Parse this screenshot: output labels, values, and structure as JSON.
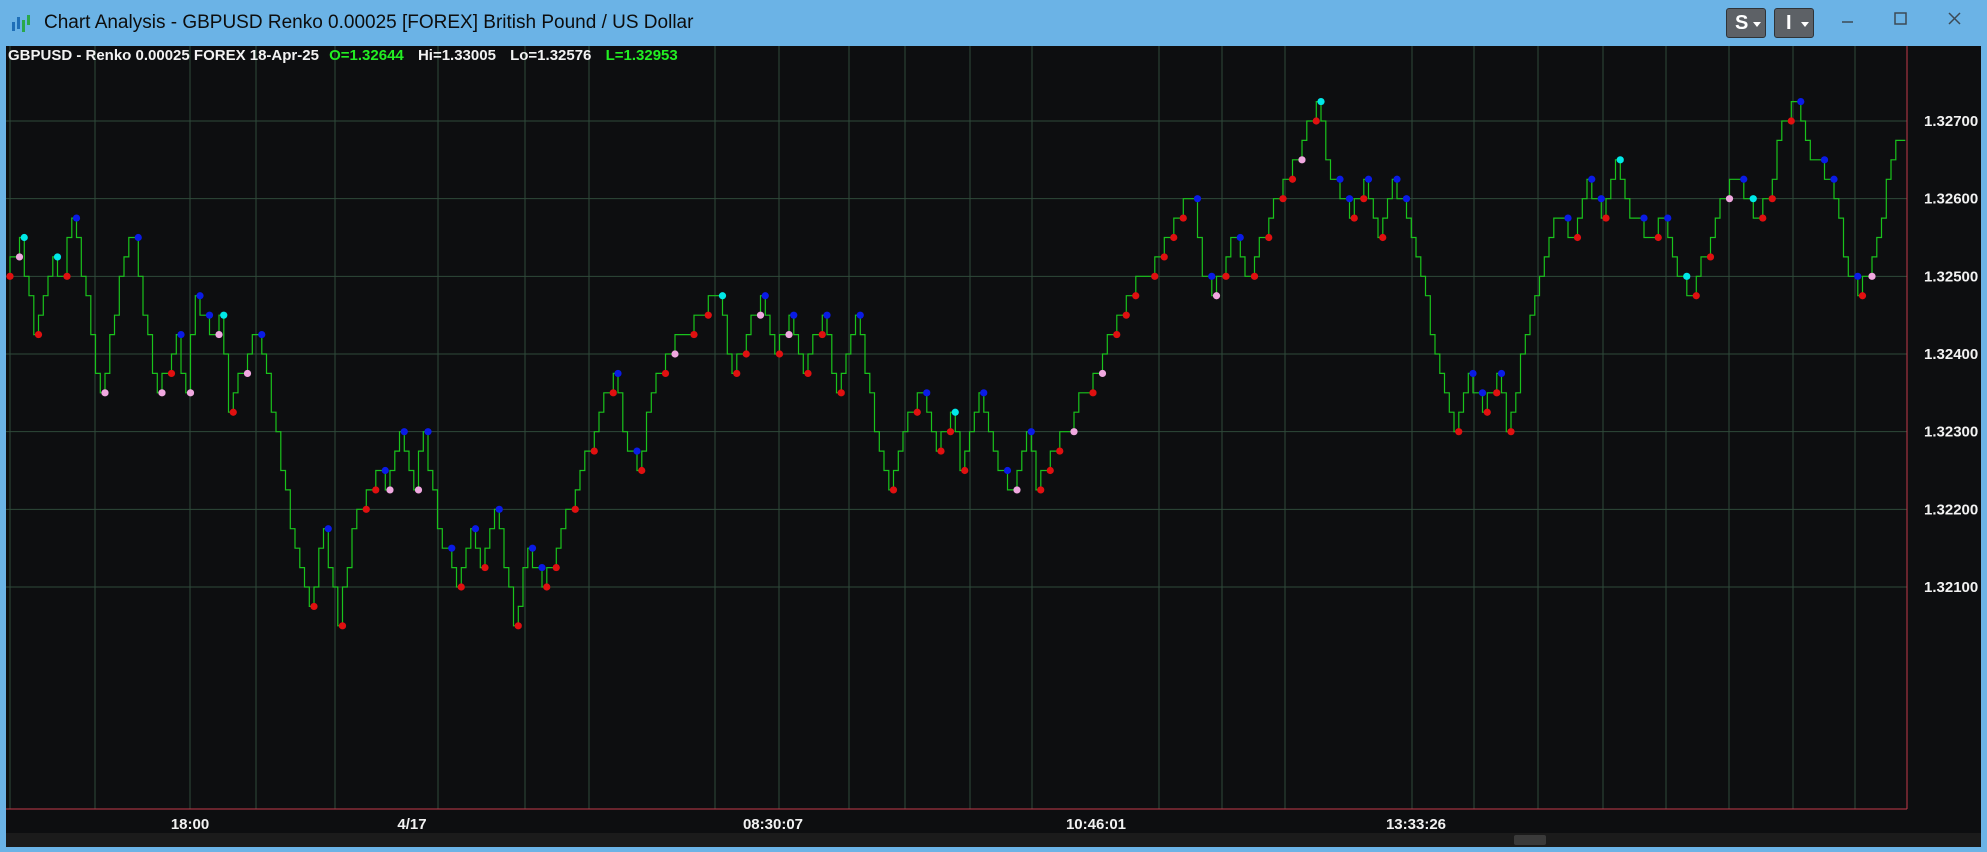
{
  "window": {
    "title": "Chart Analysis - GBPUSD Renko 0.00025 [FOREX] British Pound / US Dollar",
    "s_button_label": "S",
    "i_button_label": "I"
  },
  "colors": {
    "background": "#0d0e10",
    "grid": "#2f4a3a",
    "line": "#19c31c",
    "up_marker": "#0a1be6",
    "down_marker": "#e01010",
    "cyan_marker": "#00e8e8",
    "pink_marker": "#f0a8e0",
    "header_green": "#22ee22",
    "cursor": "#c23a4a"
  },
  "header": {
    "symbol_text": "GBPUSD - Renko 0.00025  FOREX  18-Apr-25",
    "open": "O=1.32644",
    "high": "Hi=1.33005",
    "low": "Lo=1.32576",
    "last": "L=1.32953"
  },
  "chart_data": {
    "type": "line",
    "title": "GBPUSD - Renko 0.00025",
    "brick_size": 0.00025,
    "ylim": [
      1.3201,
      1.3276
    ],
    "y_ticks": [
      "1.32100",
      "1.32200",
      "1.32300",
      "1.32400",
      "1.32500",
      "1.32600",
      "1.32700"
    ],
    "x_tick_labels": [
      "18:00",
      "4/17",
      "08:30:07",
      "10:46:01",
      "13:33:26"
    ],
    "grid": true,
    "waypoints": [
      [
        0,
        1.325
      ],
      [
        3,
        1.3255
      ],
      [
        6,
        1.32425
      ],
      [
        10,
        1.32525
      ],
      [
        12,
        1.325
      ],
      [
        14,
        1.32575
      ],
      [
        16,
        1.325
      ],
      [
        20,
        1.3235
      ],
      [
        25,
        1.32525
      ],
      [
        27,
        1.3255
      ],
      [
        29,
        1.3245
      ],
      [
        32,
        1.3235
      ],
      [
        36,
        1.32425
      ],
      [
        38,
        1.3235
      ],
      [
        40,
        1.32475
      ],
      [
        43,
        1.32425
      ],
      [
        45,
        1.3245
      ],
      [
        47,
        1.32325
      ],
      [
        52,
        1.32425
      ],
      [
        54,
        1.324
      ],
      [
        60,
        1.32175
      ],
      [
        64,
        1.32075
      ],
      [
        67,
        1.32175
      ],
      [
        70,
        1.3205
      ],
      [
        73,
        1.32175
      ],
      [
        78,
        1.3225
      ],
      [
        80,
        1.32225
      ],
      [
        83,
        1.323
      ],
      [
        86,
        1.32225
      ],
      [
        88,
        1.323
      ],
      [
        91,
        1.32175
      ],
      [
        95,
        1.321
      ],
      [
        98,
        1.32175
      ],
      [
        100,
        1.32125
      ],
      [
        103,
        1.322
      ],
      [
        107,
        1.3205
      ],
      [
        110,
        1.3215
      ],
      [
        113,
        1.321
      ],
      [
        120,
        1.32225
      ],
      [
        125,
        1.32325
      ],
      [
        128,
        1.32375
      ],
      [
        131,
        1.32275
      ],
      [
        133,
        1.3225
      ],
      [
        137,
        1.32375
      ],
      [
        142,
        1.32425
      ],
      [
        146,
        1.3245
      ],
      [
        150,
        1.32475
      ],
      [
        153,
        1.32375
      ],
      [
        156,
        1.32425
      ],
      [
        159,
        1.32475
      ],
      [
        162,
        1.324
      ],
      [
        165,
        1.3245
      ],
      [
        168,
        1.32375
      ],
      [
        172,
        1.3245
      ],
      [
        175,
        1.3235
      ],
      [
        179,
        1.3245
      ],
      [
        183,
        1.323
      ],
      [
        186,
        1.32225
      ],
      [
        190,
        1.32325
      ],
      [
        193,
        1.3235
      ],
      [
        196,
        1.32275
      ],
      [
        199,
        1.32325
      ],
      [
        201,
        1.3225
      ],
      [
        205,
        1.3235
      ],
      [
        209,
        1.3225
      ],
      [
        212,
        1.32225
      ],
      [
        215,
        1.323
      ],
      [
        217,
        1.32225
      ],
      [
        220,
        1.32275
      ],
      [
        223,
        1.323
      ],
      [
        227,
        1.3235
      ],
      [
        233,
        1.32425
      ],
      [
        236,
        1.32475
      ],
      [
        240,
        1.325
      ],
      [
        243,
        1.32525
      ],
      [
        246,
        1.32575
      ],
      [
        250,
        1.326
      ],
      [
        252,
        1.325
      ],
      [
        254,
        1.32475
      ],
      [
        258,
        1.3255
      ],
      [
        262,
        1.325
      ],
      [
        266,
        1.32575
      ],
      [
        270,
        1.32625
      ],
      [
        273,
        1.32675
      ],
      [
        276,
        1.32725
      ],
      [
        279,
        1.32625
      ],
      [
        283,
        1.32575
      ],
      [
        286,
        1.32625
      ],
      [
        289,
        1.3255
      ],
      [
        292,
        1.32625
      ],
      [
        296,
        1.3255
      ],
      [
        302,
        1.32375
      ],
      [
        305,
        1.323
      ],
      [
        308,
        1.32375
      ],
      [
        311,
        1.32325
      ],
      [
        314,
        1.32375
      ],
      [
        316,
        1.323
      ],
      [
        322,
        1.32475
      ],
      [
        326,
        1.32575
      ],
      [
        330,
        1.3255
      ],
      [
        333,
        1.32625
      ],
      [
        336,
        1.32575
      ],
      [
        339,
        1.3265
      ],
      [
        342,
        1.32575
      ],
      [
        346,
        1.3255
      ],
      [
        349,
        1.32575
      ],
      [
        352,
        1.325
      ],
      [
        355,
        1.32475
      ],
      [
        360,
        1.32575
      ],
      [
        364,
        1.32625
      ],
      [
        368,
        1.32575
      ],
      [
        371,
        1.326
      ],
      [
        374,
        1.327
      ],
      [
        377,
        1.32725
      ],
      [
        380,
        1.3265
      ],
      [
        384,
        1.32625
      ],
      [
        388,
        1.325
      ],
      [
        390,
        1.32475
      ],
      [
        394,
        1.3255
      ],
      [
        397,
        1.3265
      ],
      [
        399,
        1.32675
      ]
    ]
  }
}
